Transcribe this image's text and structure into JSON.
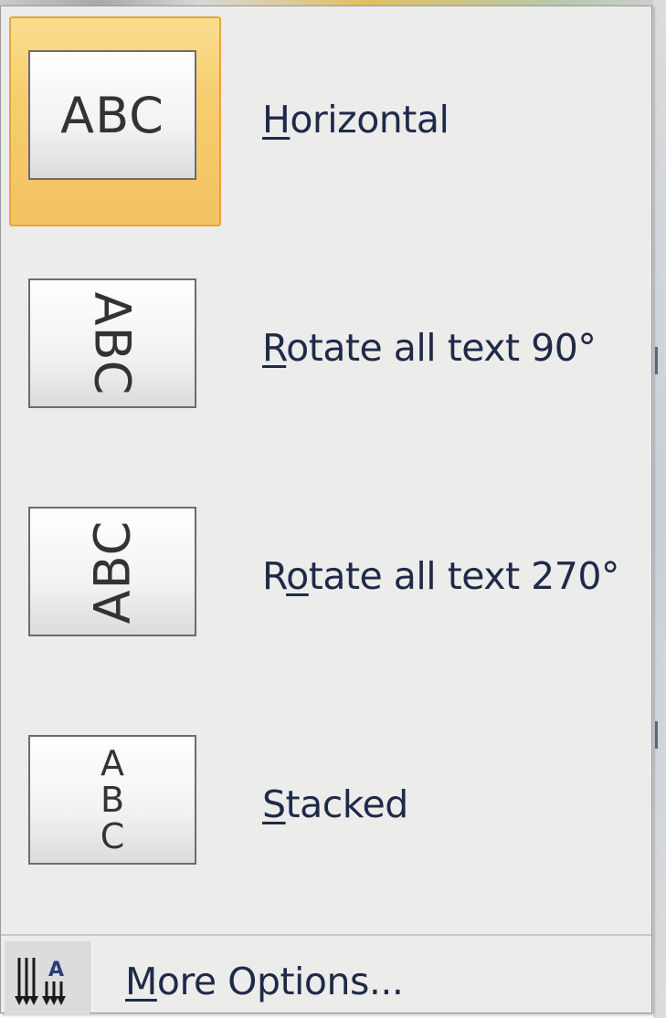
{
  "menu": {
    "items": [
      {
        "id": "horizontal",
        "thumb_text": "ABC",
        "label_key": "H",
        "label_rest": "orizontal",
        "orientation": "horizontal",
        "selected": true
      },
      {
        "id": "rotate-90",
        "thumb_text": "ABC",
        "label_key": "R",
        "label_rest": "otate all text 90°",
        "orientation": "rotate-90",
        "selected": false
      },
      {
        "id": "rotate-270",
        "thumb_text": "ABC",
        "label_pre": "R",
        "label_key": "o",
        "label_rest": "tate all text 270°",
        "orientation": "rotate-270",
        "selected": false
      },
      {
        "id": "stacked",
        "thumb_letters": [
          "A",
          "B",
          "C"
        ],
        "label_key": "S",
        "label_rest": "tacked",
        "orientation": "stacked",
        "selected": false
      }
    ],
    "more_options": {
      "label_key": "M",
      "label_rest": "ore Options...",
      "icon": "text-direction-icon"
    }
  },
  "colors": {
    "highlight_fill": "#f6cd6e",
    "highlight_border": "#e3a542",
    "label_text": "#1f2a4a",
    "menu_background": "#ececea"
  }
}
